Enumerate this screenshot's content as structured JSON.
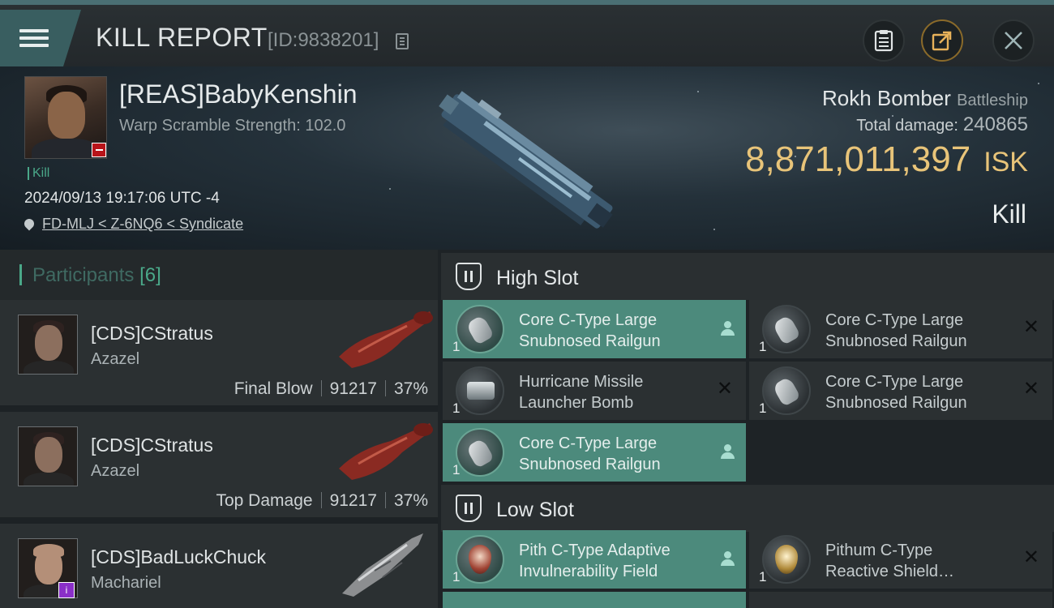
{
  "header": {
    "title": "KILL REPORT",
    "report_id": "[ID:9838201]",
    "menu_icon": "hamburger-menu-icon",
    "copy_icon": "copy-icon",
    "buttons": [
      "clipboard-icon",
      "share-icon",
      "close-icon"
    ],
    "share_color": "#c8963a"
  },
  "victim": {
    "name": "[REAS]BabyKenshin",
    "warp_scramble": "Warp Scramble Strength: 102.0",
    "kill_tag": "Kill",
    "timestamp": "2024/09/13 19:17:06 UTC -4",
    "location": "FD-MLJ < Z-6NQ6 < Syndicate",
    "ship_name": "Rokh Bomber",
    "ship_class": "Battleship",
    "total_damage_label": "Total damage:",
    "total_damage": "240865",
    "isk_value": "8,871,011,397",
    "isk_unit": "ISK",
    "result": "Kill",
    "isk_color": "#e8c479"
  },
  "participants": {
    "label": "Participants",
    "count": "[6]",
    "rows": [
      {
        "name": "[CDS]CStratus",
        "ship": "Azazel",
        "role": "Final Blow",
        "damage": "91217",
        "percent": "37%"
      },
      {
        "name": "[CDS]CStratus",
        "ship": "Azazel",
        "role": "Top Damage",
        "damage": "91217",
        "percent": "37%"
      },
      {
        "name": "[CDS]BadLuckChuck",
        "ship": "Machariel",
        "badge": "i"
      }
    ]
  },
  "fitting": {
    "high_slot": {
      "label": "High Slot",
      "modules": [
        {
          "name_line1": "Core C-Type Large",
          "name_line2": "Snubnosed Railgun",
          "qty": "1",
          "status": "fitted"
        },
        {
          "name_line1": "Core C-Type Large",
          "name_line2": "Snubnosed Railgun",
          "qty": "1",
          "status": "destroyed"
        },
        {
          "name_line1": "Hurricane Missile",
          "name_line2": "Launcher Bomb",
          "qty": "1",
          "status": "destroyed"
        },
        {
          "name_line1": "Core C-Type Large",
          "name_line2": "Snubnosed Railgun",
          "qty": "1",
          "status": "destroyed"
        },
        {
          "name_line1": "Core C-Type Large",
          "name_line2": "Snubnosed Railgun",
          "qty": "1",
          "status": "fitted"
        }
      ]
    },
    "low_slot": {
      "label": "Low Slot",
      "modules": [
        {
          "name_line1": "Pith C-Type Adaptive",
          "name_line2": "Invulnerability Field",
          "qty": "1",
          "status": "fitted"
        },
        {
          "name_line1": "Pithum C-Type",
          "name_line2": "Reactive Shield…",
          "qty": "1",
          "status": "destroyed"
        }
      ]
    },
    "accent_color": "#4c8a7c"
  }
}
